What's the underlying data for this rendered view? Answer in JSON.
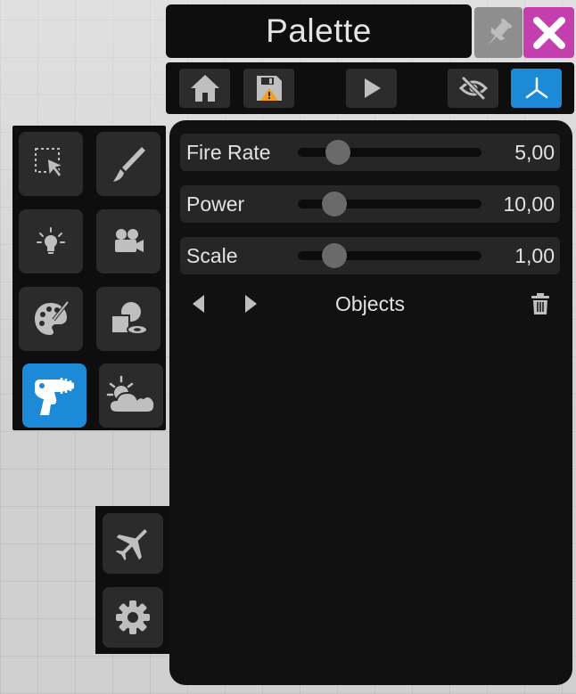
{
  "window": {
    "title": "Palette"
  },
  "title_actions": [
    {
      "name": "pin",
      "icon": "pin-icon",
      "color": "#8e8e8e"
    },
    {
      "name": "close",
      "icon": "close-icon",
      "color": "#c23fad"
    }
  ],
  "toolbar": {
    "buttons": [
      {
        "icon": "home-icon"
      },
      {
        "icon": "save-warning-icon"
      },
      {
        "icon": "play-icon"
      },
      {
        "icon": "eye-off-icon"
      },
      {
        "icon": "axes-icon",
        "active": true
      }
    ]
  },
  "side_tools": [
    {
      "icon": "select-icon"
    },
    {
      "icon": "brush-icon"
    },
    {
      "icon": "light-icon"
    },
    {
      "icon": "camera-icon"
    },
    {
      "icon": "palette-icon"
    },
    {
      "icon": "shapes-icon"
    },
    {
      "icon": "raygun-icon",
      "active": true
    },
    {
      "icon": "weather-icon"
    }
  ],
  "bottom_tools": [
    {
      "icon": "airplane-icon"
    },
    {
      "icon": "settings-icon"
    }
  ],
  "sliders": [
    {
      "label": "Fire Rate",
      "value": "5,00",
      "position": 0.22
    },
    {
      "label": "Power",
      "value": "10,00",
      "position": 0.2
    },
    {
      "label": "Scale",
      "value": "1,00",
      "position": 0.2
    }
  ],
  "objects": {
    "label": "Objects"
  },
  "colors": {
    "accent": "#1d8ad8",
    "close": "#c23fad",
    "panel": "#111111",
    "row": "#262626"
  }
}
